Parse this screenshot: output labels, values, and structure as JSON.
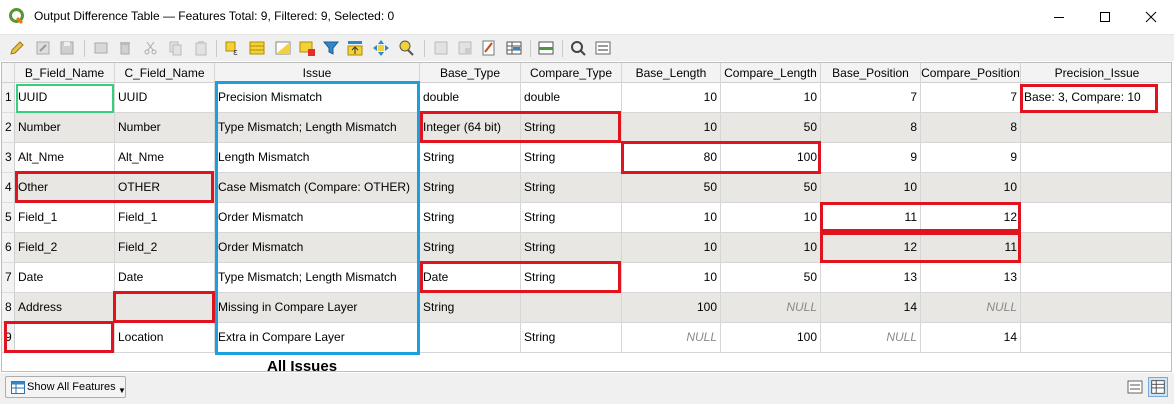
{
  "window": {
    "title": "Output Difference Table — Features Total: 9, Filtered: 9, Selected: 0",
    "controls": [
      "minimize",
      "maximize",
      "close"
    ]
  },
  "toolbar": {
    "icons": [
      "pencil-icon",
      "multi-edit-icon",
      "save-edits-icon",
      "add-feature-icon",
      "delete-feature-icon",
      "cut-icon",
      "copy-icon",
      "paste-icon",
      "select-by-expression-icon",
      "select-all-icon",
      "invert-selection-icon",
      "deselect-all-icon",
      "filter-icon",
      "move-selection-to-top-icon",
      "pan-to-selection-icon",
      "zoom-to-selection-icon",
      "new-field-icon",
      "delete-field-icon",
      "field-calculator-icon",
      "conditional-formatting-icon",
      "dock-icon",
      "actions-icon",
      "form-view-icon"
    ]
  },
  "table": {
    "columns": [
      "B_Field_Name",
      "C_Field_Name",
      "Issue",
      "Base_Type",
      "Compare_Type",
      "Base_Length",
      "Compare_Length",
      "Base_Position",
      "Compare_Position",
      "Precision_Issue"
    ],
    "rows": [
      {
        "num": "1",
        "b": "UUID",
        "c": "UUID",
        "issue": "Precision Mismatch",
        "btype": "double",
        "ctype": "double",
        "blen": "10",
        "clen": "10",
        "bpos": "7",
        "cpos": "7",
        "prec": "Base: 3, Compare: 10"
      },
      {
        "num": "2",
        "b": "Number",
        "c": "Number",
        "issue": "Type Mismatch; Length Mismatch",
        "btype": "Integer (64 bit)",
        "ctype": "String",
        "blen": "10",
        "clen": "50",
        "bpos": "8",
        "cpos": "8",
        "prec": ""
      },
      {
        "num": "3",
        "b": "Alt_Nme",
        "c": "Alt_Nme",
        "issue": "Length Mismatch",
        "btype": "String",
        "ctype": "String",
        "blen": "80",
        "clen": "100",
        "bpos": "9",
        "cpos": "9",
        "prec": ""
      },
      {
        "num": "4",
        "b": "Other",
        "c": "OTHER",
        "issue": "Case Mismatch (Compare: OTHER)",
        "btype": "String",
        "ctype": "String",
        "blen": "50",
        "clen": "50",
        "bpos": "10",
        "cpos": "10",
        "prec": ""
      },
      {
        "num": "5",
        "b": "Field_1",
        "c": "Field_1",
        "issue": "Order Mismatch",
        "btype": "String",
        "ctype": "String",
        "blen": "10",
        "clen": "10",
        "bpos": "11",
        "cpos": "12",
        "prec": ""
      },
      {
        "num": "6",
        "b": "Field_2",
        "c": "Field_2",
        "issue": "Order Mismatch",
        "btype": "String",
        "ctype": "String",
        "blen": "10",
        "clen": "10",
        "bpos": "12",
        "cpos": "11",
        "prec": ""
      },
      {
        "num": "7",
        "b": "Date",
        "c": "Date",
        "issue": "Type Mismatch; Length Mismatch",
        "btype": "Date",
        "ctype": "String",
        "blen": "10",
        "clen": "50",
        "bpos": "13",
        "cpos": "13",
        "prec": ""
      },
      {
        "num": "8",
        "b": "Address",
        "c": "",
        "issue": "Missing in Compare Layer",
        "btype": "String",
        "ctype": "",
        "blen": "100",
        "clen": "NULL",
        "bpos": "14",
        "cpos": "NULL",
        "prec": ""
      },
      {
        "num": "9",
        "b": "",
        "c": "Location",
        "issue": "Extra in Compare Layer",
        "btype": "",
        "ctype": "String",
        "blen": "NULL",
        "clen": "100",
        "bpos": "NULL",
        "cpos": "14",
        "prec": ""
      }
    ],
    "null_text": "NULL"
  },
  "annotation": {
    "caption": "All Issues",
    "colors": {
      "red": "#e0141f",
      "blue": "#1aa0df",
      "green": "#35d07f"
    }
  },
  "bottom": {
    "show_features_label": "Show All Features",
    "view_buttons": [
      "table-view-icon",
      "form-view-icon"
    ]
  }
}
